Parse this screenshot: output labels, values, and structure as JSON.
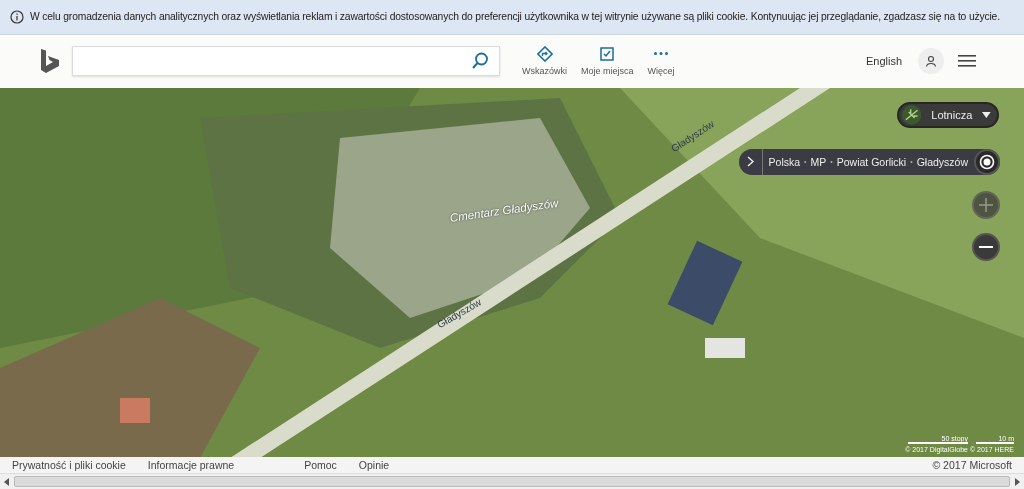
{
  "cookie_banner": {
    "text": "W celu gromadzenia danych analitycznych oraz wyświetlania reklam i zawartości dostosowanych do preferencji użytkownika w tej witrynie używane są pliki cookie. Kontynuując jej przeglądanie, zgadzasz się na to użycie."
  },
  "header": {
    "nav_items": [
      {
        "label": "Wskazówki",
        "kind": "directions"
      },
      {
        "label": "Moje miejsca",
        "kind": "places"
      },
      {
        "label": "Więcej",
        "kind": "more"
      }
    ],
    "language": "English"
  },
  "map": {
    "labels": [
      {
        "text": "Cmentarz Gładyszów",
        "kind": "place"
      },
      {
        "text": "Gładyszów",
        "kind": "road"
      },
      {
        "text": "Gładyszów",
        "kind": "road"
      }
    ],
    "style_selector": {
      "label": "Lotnicza"
    },
    "breadcrumb": {
      "separator": "•",
      "items": [
        "Polska",
        "MP",
        "Powiat Gorlicki",
        "Gładyszów"
      ]
    },
    "scale": [
      "50 stopy",
      "10 m"
    ],
    "attribution": "© 2017 DigitalGlobe © 2017 HERE"
  },
  "footer": {
    "links": [
      "Prywatność i pliki cookie",
      "Informacje prawne",
      "Pomoc",
      "Opinie"
    ],
    "copyright": "© 2017 Microsoft"
  }
}
